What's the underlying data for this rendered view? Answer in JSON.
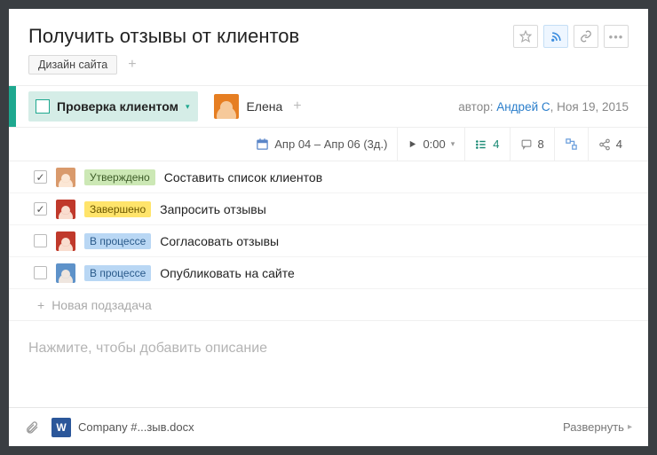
{
  "title": "Получить отзывы от клиентов",
  "tags": [
    "Дизайн сайта"
  ],
  "status": {
    "label": "Проверка клиентом"
  },
  "assignee": {
    "name": "Елена"
  },
  "author": {
    "prefix": "автор: ",
    "name": "Андрей С",
    "date": ", Ноя 19, 2015"
  },
  "meta": {
    "dates": "Апр 04 – Апр 06 (3д.)",
    "timer": "0:00",
    "subtask_count": "4",
    "comment_count": "8",
    "share_count": "4"
  },
  "subtasks": [
    {
      "checked": true,
      "avatar": "a1",
      "status": "Утверждено",
      "badge": "badge-green",
      "title": "Составить список клиентов"
    },
    {
      "checked": true,
      "avatar": "a2",
      "status": "Завершено",
      "badge": "badge-yellow",
      "title": "Запросить отзывы"
    },
    {
      "checked": false,
      "avatar": "a2",
      "status": "В процессе",
      "badge": "badge-blue",
      "title": "Согласовать отзывы"
    },
    {
      "checked": false,
      "avatar": "a3",
      "status": "В процессе",
      "badge": "badge-blue",
      "title": "Опубликовать на сайте"
    }
  ],
  "new_subtask": "Новая подзадача",
  "description_placeholder": "Нажмите, чтобы добавить описание",
  "attachment": {
    "name": "Company #...зыв.docx"
  },
  "expand": "Развернуть"
}
